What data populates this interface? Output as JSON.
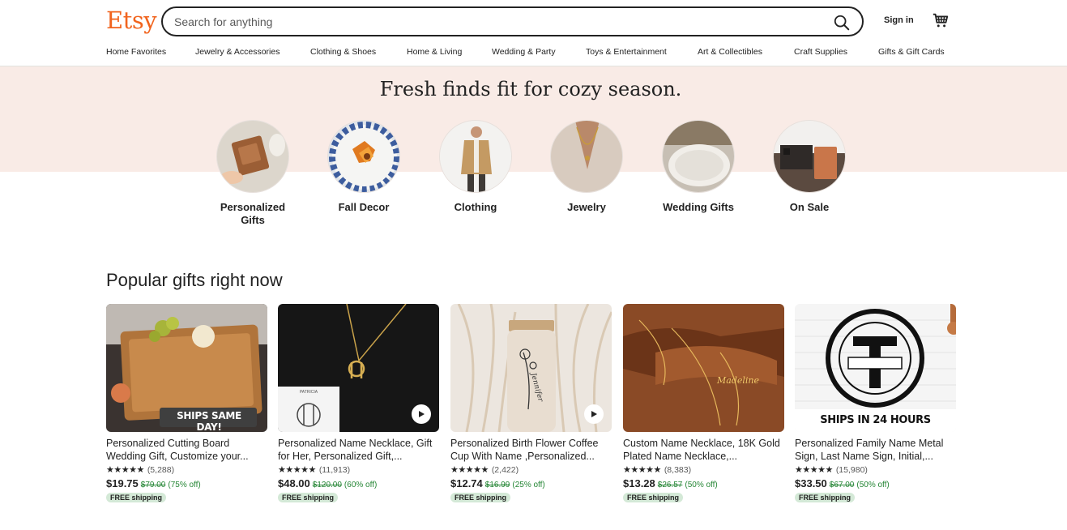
{
  "header": {
    "logo": "Etsy",
    "search_placeholder": "Search for anything",
    "signin_label": "Sign in"
  },
  "nav": [
    "Home Favorites",
    "Jewelry & Accessories",
    "Clothing & Shoes",
    "Home & Living",
    "Wedding & Party",
    "Toys & Entertainment",
    "Art & Collectibles",
    "Craft Supplies",
    "Gifts & Gift Cards"
  ],
  "hero": {
    "title": "Fresh finds fit for cozy season.",
    "categories": [
      {
        "label": "Personalized Gifts"
      },
      {
        "label": "Fall Decor"
      },
      {
        "label": "Clothing"
      },
      {
        "label": "Jewelry"
      },
      {
        "label": "Wedding Gifts"
      },
      {
        "label": "On Sale"
      }
    ]
  },
  "popular": {
    "title": "Popular gifts right now",
    "items": [
      {
        "title": "Personalized Cutting Board Wedding Gift, Customize your...",
        "stars": "★★★★★",
        "reviews": "(5,288)",
        "price": "$19.75",
        "original": "$79.00",
        "discount": "(75% off)",
        "badge": "FREE shipping",
        "overlay": "SHIPS SAME DAY!"
      },
      {
        "title": "Personalized Name Necklace, Gift for Her, Personalized Gift,...",
        "stars": "★★★★★",
        "reviews": "(11,913)",
        "price": "$48.00",
        "original": "$120.00",
        "discount": "(60% off)",
        "badge": "FREE shipping",
        "overlay": "PATRICIA"
      },
      {
        "title": "Personalized Birth Flower Coffee Cup With Name ,Personalized...",
        "stars": "★★★★★",
        "reviews": "(2,422)",
        "price": "$12.74",
        "original": "$16.99",
        "discount": "(25% off)",
        "badge": "FREE shipping",
        "overlay": "Jennifer"
      },
      {
        "title": "Custom Name Necklace, 18K Gold Plated Name Necklace,...",
        "stars": "★★★★★",
        "reviews": "(8,383)",
        "price": "$13.28",
        "original": "$26.57",
        "discount": "(50% off)",
        "badge": "FREE shipping",
        "overlay": "Madeline"
      },
      {
        "title": "Personalized Family Name Metal Sign, Last Name Sign, Initial,...",
        "stars": "★★★★★",
        "reviews": "(15,980)",
        "price": "$33.50",
        "original": "$67.00",
        "discount": "(50% off)",
        "badge": "FREE shipping",
        "overlay": "SHIPS IN 24 HOURS"
      }
    ]
  },
  "colors": {
    "brand": "#f1641e",
    "hero_bg": "#f9ebe6",
    "discount_green": "#258635",
    "badge_bg": "#d4e9d7"
  }
}
